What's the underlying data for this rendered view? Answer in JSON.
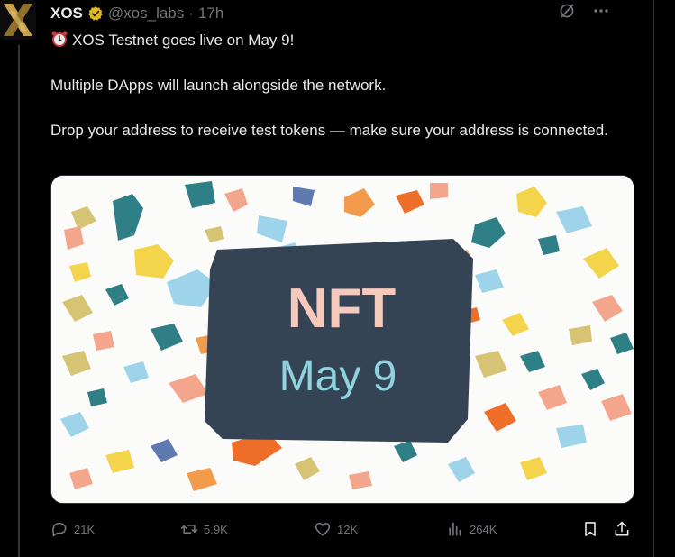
{
  "tweet": {
    "author_name": "XOS",
    "handle": "@xos_labs",
    "separator": "·",
    "time": "17h",
    "lines": [
      "XOS Testnet goes live on May 9!",
      "Multiple DApps will launch alongside the network.",
      "Drop your address to receive test tokens — make sure your address is connected."
    ]
  },
  "media": {
    "headline": "NFT",
    "date": "May 9",
    "board_color": "#344454",
    "headline_color": "#f6c9bd",
    "date_color": "#8fd3df"
  },
  "actions": {
    "replies": "21K",
    "reposts": "5.9K",
    "likes": "12K",
    "views": "264K"
  },
  "colors": {
    "background": "#000000",
    "text": "#e7e9ea",
    "muted": "#71767b",
    "verified_gold": "#e2b719",
    "logo_gold": "#c9a24a"
  },
  "icons": {
    "avatar": "xos-logo",
    "verified": "verified-badge-icon",
    "grok": "grok-icon",
    "more": "more-icon",
    "alarm": "alarm-clock-icon",
    "reply": "reply-icon",
    "repost": "repost-icon",
    "like": "heart-icon",
    "views": "views-icon",
    "bookmark": "bookmark-icon",
    "share": "share-icon"
  }
}
